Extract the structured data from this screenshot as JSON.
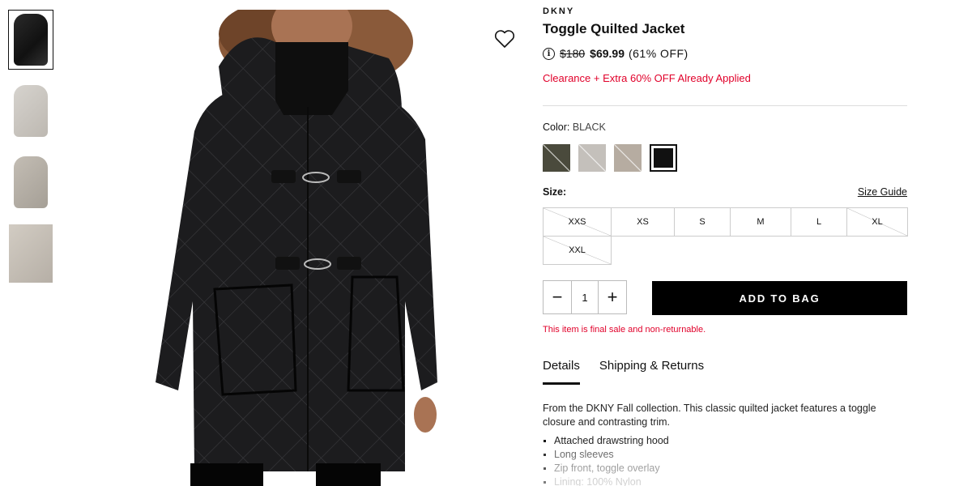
{
  "thumbnails": [
    {
      "name": "thumbnail-1",
      "active": true
    },
    {
      "name": "thumbnail-2",
      "active": false
    },
    {
      "name": "thumbnail-3",
      "active": false
    },
    {
      "name": "thumbnail-4",
      "active": false
    }
  ],
  "product": {
    "brand": "DKNY",
    "title": "Toggle Quilted Jacket",
    "original_price": "$180",
    "sale_price": "$69.99",
    "discount": "(61% OFF)",
    "promo": "Clearance + Extra 60% OFF Already Applied"
  },
  "color": {
    "label": "Color:",
    "value": "BLACK",
    "swatches": [
      {
        "name": "olive",
        "hex": "#4a4a3c",
        "selected": false
      },
      {
        "name": "light-gray",
        "hex": "#c4c0bb",
        "selected": false
      },
      {
        "name": "taupe",
        "hex": "#b6aca1",
        "selected": false
      },
      {
        "name": "black",
        "hex": "#111111",
        "selected": true
      }
    ]
  },
  "size": {
    "label": "Size:",
    "guide_label": "Size Guide",
    "options": [
      {
        "label": "XXS",
        "available": false
      },
      {
        "label": "XS",
        "available": true
      },
      {
        "label": "S",
        "available": true
      },
      {
        "label": "M",
        "available": true
      },
      {
        "label": "L",
        "available": true
      },
      {
        "label": "XL",
        "available": false
      },
      {
        "label": "XXL",
        "available": false
      }
    ]
  },
  "quantity": {
    "minus": "−",
    "value": "1",
    "plus": "+"
  },
  "add_to_bag": "ADD TO BAG",
  "final_sale_note": "This item is final sale and non-returnable.",
  "tabs": [
    {
      "label": "Details",
      "active": true
    },
    {
      "label": "Shipping & Returns",
      "active": false
    }
  ],
  "description": "From the DKNY Fall collection. This classic quilted jacket features a toggle closure and contrasting trim.",
  "features": [
    "Attached drawstring hood",
    "Long sleeves",
    "Zip front, toggle overlay",
    "Lining: 100% Nylon"
  ],
  "icons": {
    "info": "info-icon",
    "wishlist": "heart-icon"
  },
  "colors": {
    "promo_red": "#e1002a",
    "button_black": "#000000"
  }
}
